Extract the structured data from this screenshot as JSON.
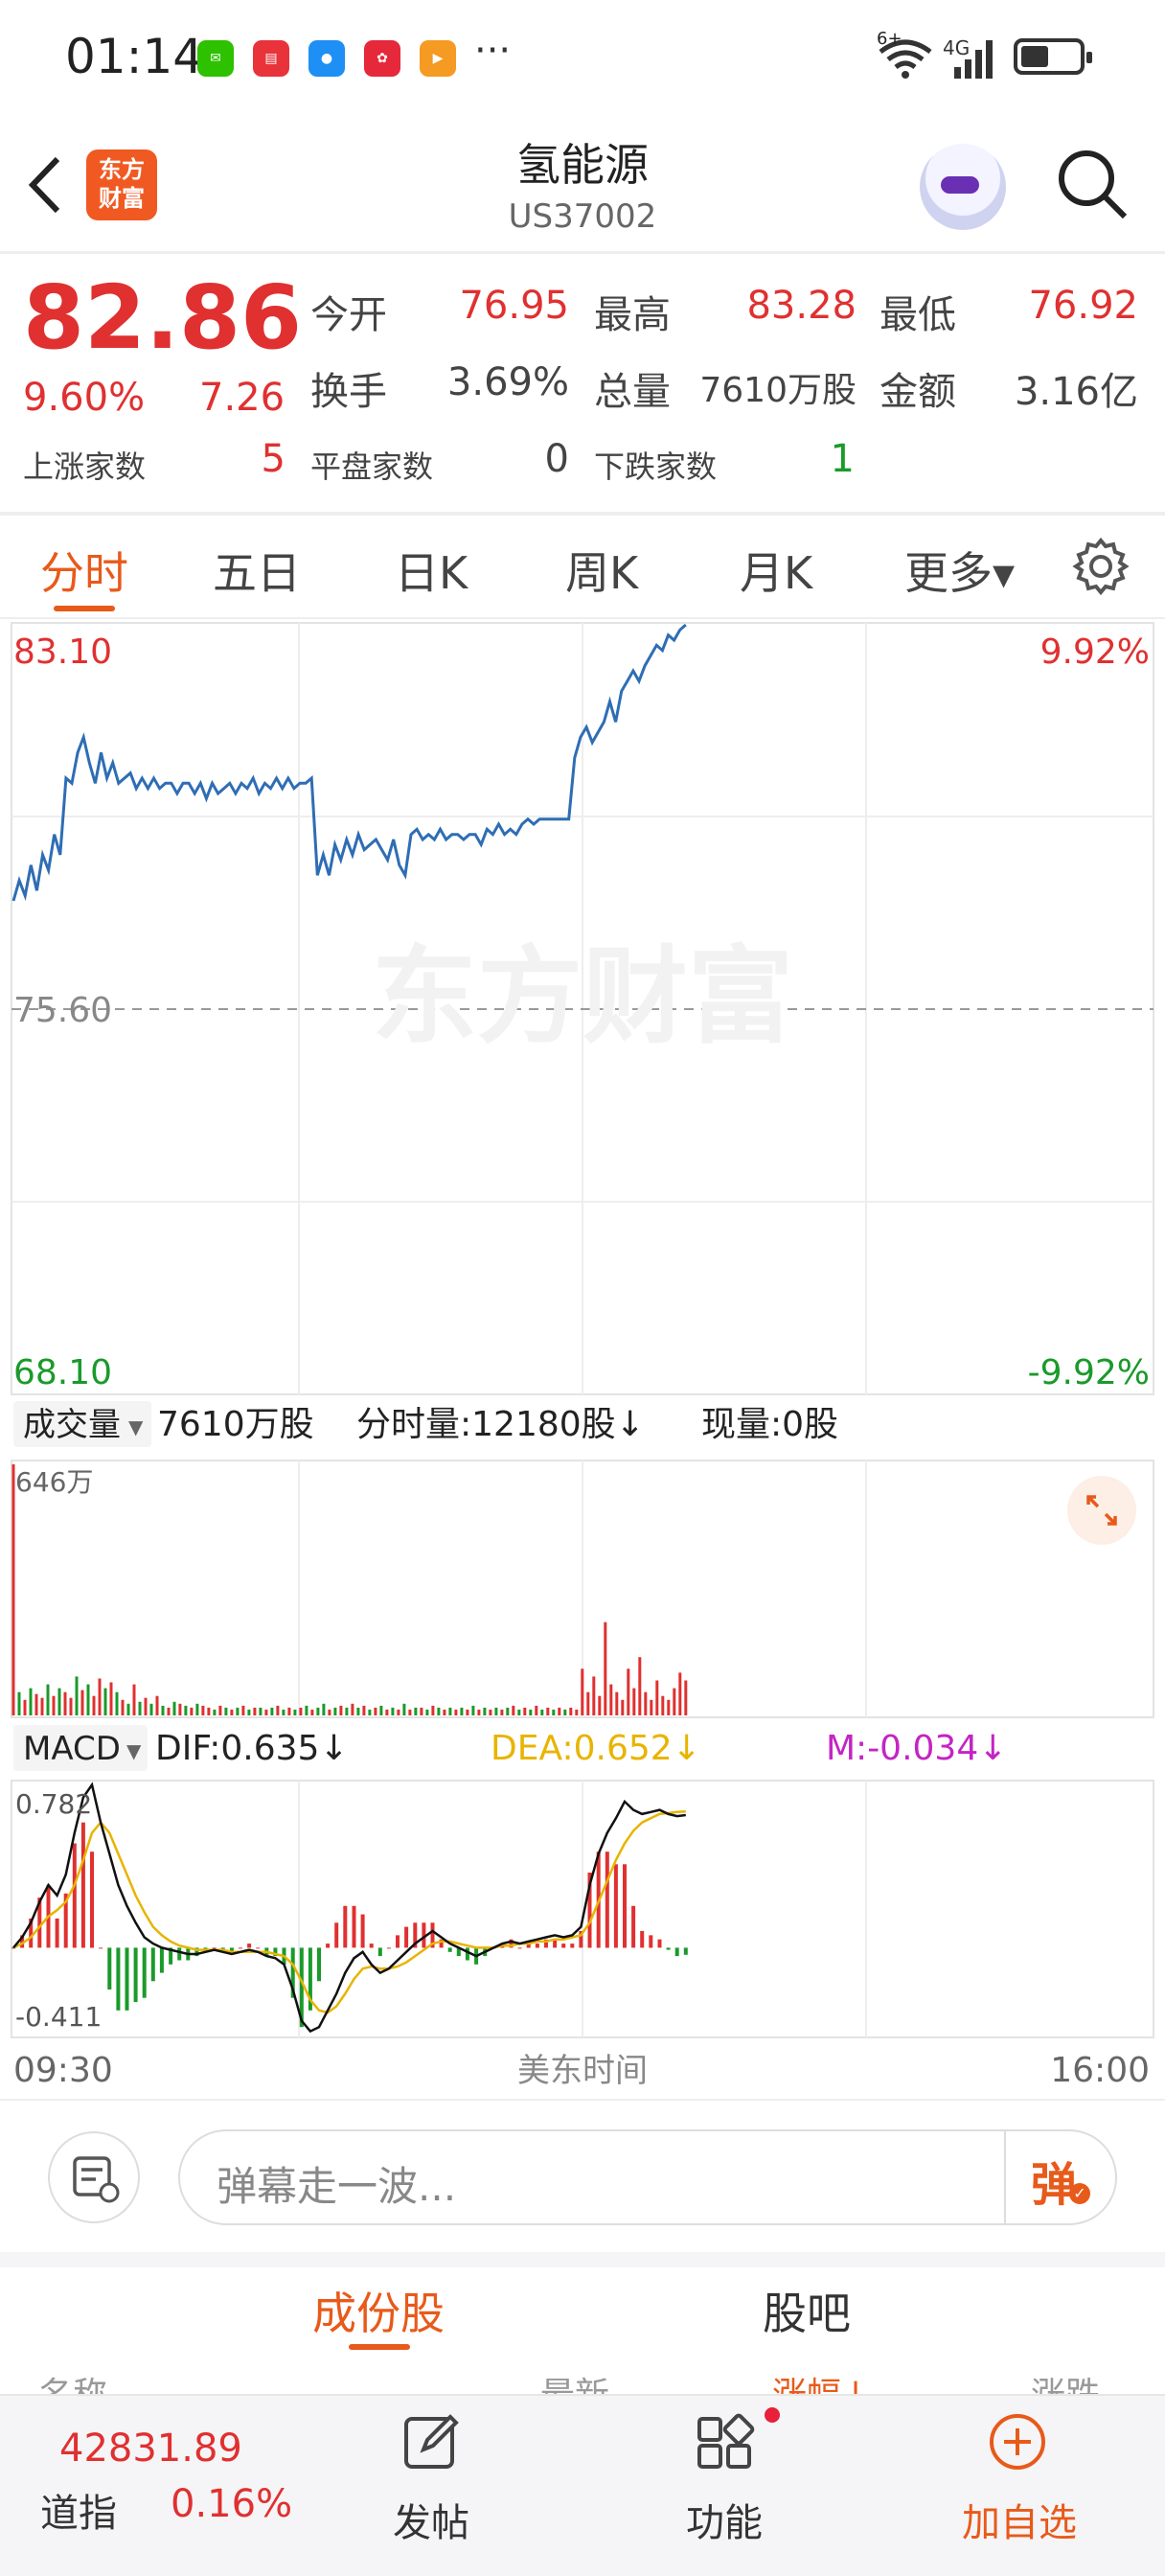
{
  "status_bar": {
    "time": "01:14",
    "dots": "···",
    "net_label": "6+",
    "cell_label": "4G",
    "apps": [
      {
        "name": "wechat",
        "color": "#2dc100"
      },
      {
        "name": "notes",
        "color": "#e8333a"
      },
      {
        "name": "messages",
        "color": "#1e8ff5"
      },
      {
        "name": "huawei-store",
        "color": "#e5283a"
      },
      {
        "name": "video",
        "color": "#f59a23"
      }
    ]
  },
  "header": {
    "logo_line1": "东方",
    "logo_line2": "财富",
    "title": "氢能源",
    "code": "US37002"
  },
  "quote": {
    "price": "82.86",
    "change_pct": "9.60%",
    "change": "7.26",
    "stats": [
      {
        "label": "今开",
        "value": "76.95",
        "color": "red"
      },
      {
        "label": "最高",
        "value": "83.28",
        "color": "red"
      },
      {
        "label": "最低",
        "value": "76.92",
        "color": "red"
      },
      {
        "label": "换手",
        "value": "3.69%",
        "color": "gray"
      },
      {
        "label": "总量",
        "value": "7610万股",
        "color": "gray"
      },
      {
        "label": "金额",
        "value": "3.16亿",
        "color": "gray"
      }
    ],
    "breadth": [
      {
        "label": "上涨家数",
        "value": "5",
        "color": "red"
      },
      {
        "label": "平盘家数",
        "value": "0",
        "color": "gray"
      },
      {
        "label": "下跌家数",
        "value": "1",
        "color": "green"
      }
    ]
  },
  "tabs": [
    {
      "label": "分时",
      "active": true
    },
    {
      "label": "五日",
      "active": false
    },
    {
      "label": "日K",
      "active": false
    },
    {
      "label": "周K",
      "active": false
    },
    {
      "label": "月K",
      "active": false
    },
    {
      "label": "更多▾",
      "active": false
    }
  ],
  "chart_labels": {
    "top_price": "83.10",
    "top_pct": "9.92%",
    "mid_price": "75.60",
    "bottom_price": "68.10",
    "bottom_pct": "-9.92%",
    "watermark": "东方财富",
    "volume_selector": "成交量",
    "volume_total": "7610万股",
    "minute_volume": "分时量:12180股↓",
    "current_volume": "现量:0股",
    "volume_max": "646万",
    "macd_selector": "MACD",
    "dif": "DIF:0.635↓",
    "dea": "DEA:0.652↓",
    "m": "M:-0.034↓",
    "macd_max": "0.782",
    "macd_min": "-0.411",
    "time_start": "09:30",
    "time_mid": "美东时间",
    "time_end": "16:00"
  },
  "chart_data": [
    {
      "type": "line",
      "name": "price",
      "ylim": [
        68.1,
        83.1
      ],
      "baseline": 75.6,
      "x_range": [
        "09:30",
        "16:00"
      ],
      "x": [
        0,
        2,
        4,
        6,
        8,
        10,
        12,
        14,
        16,
        18,
        20,
        22,
        24,
        26,
        28,
        30,
        32,
        34,
        36,
        38,
        40,
        42,
        44,
        46,
        48,
        50,
        52,
        54,
        56,
        58,
        60,
        62,
        64,
        66,
        68,
        70,
        72,
        74,
        76,
        78,
        80,
        82,
        84,
        86,
        88,
        90,
        92,
        94,
        96,
        98,
        100,
        102,
        104,
        106,
        108,
        110,
        112,
        114,
        116,
        118,
        120,
        122,
        124,
        126,
        128,
        130,
        132,
        134,
        136,
        138,
        140,
        142,
        144,
        146,
        148,
        150,
        152,
        154,
        156,
        158,
        160,
        162,
        164,
        166,
        168,
        170,
        172,
        174,
        176,
        178,
        180,
        182,
        184,
        186,
        188,
        190,
        192,
        194,
        196,
        198,
        200,
        202,
        204,
        206,
        208,
        210,
        212,
        214,
        216,
        218,
        220,
        222,
        224,
        226,
        228,
        230
      ],
      "values": [
        77.7,
        78.1,
        77.8,
        78.4,
        77.9,
        78.6,
        78.3,
        79.0,
        78.6,
        80.1,
        80.0,
        80.6,
        80.9,
        80.4,
        80.0,
        80.6,
        80.1,
        80.4,
        80.0,
        80.1,
        80.2,
        79.9,
        80.1,
        79.9,
        80.1,
        79.9,
        80.0,
        80.0,
        79.8,
        80.0,
        80.0,
        79.8,
        80.0,
        79.7,
        80.0,
        79.8,
        79.9,
        80.0,
        79.8,
        80.0,
        79.9,
        80.1,
        79.8,
        80.0,
        79.9,
        80.1,
        79.9,
        80.1,
        79.9,
        80.0,
        80.0,
        80.1,
        78.2,
        78.6,
        78.2,
        78.8,
        78.5,
        78.9,
        78.6,
        79.0,
        78.7,
        78.8,
        78.9,
        78.7,
        78.5,
        78.9,
        78.4,
        78.2,
        79.0,
        79.1,
        78.9,
        79.0,
        78.9,
        79.1,
        78.9,
        79.0,
        79.0,
        78.9,
        79.0,
        79.0,
        78.8,
        79.1,
        79.0,
        79.2,
        79.0,
        79.1,
        79.0,
        79.2,
        79.3,
        79.2,
        79.3,
        79.3,
        79.3,
        79.3,
        79.3,
        79.3,
        80.5,
        80.9,
        81.1,
        80.8,
        81.0,
        81.2,
        81.6,
        81.2,
        81.8,
        82.0,
        82.2,
        82.0,
        82.3,
        82.5,
        82.7,
        82.6,
        82.9,
        82.8,
        83.0,
        83.1
      ]
    },
    {
      "type": "bar",
      "name": "volume",
      "ylim": [
        0,
        646
      ],
      "unit": "万股",
      "values": [
        646,
        60,
        40,
        70,
        55,
        45,
        80,
        50,
        70,
        60,
        45,
        100,
        65,
        80,
        50,
        95,
        70,
        85,
        60,
        40,
        30,
        80,
        35,
        45,
        30,
        50,
        25,
        20,
        35,
        30,
        25,
        20,
        30,
        25,
        20,
        15,
        25,
        20,
        15,
        20,
        25,
        15,
        20,
        20,
        15,
        20,
        25,
        15,
        20,
        15,
        20,
        25,
        15,
        20,
        30,
        15,
        20,
        25,
        20,
        30,
        20,
        25,
        15,
        20,
        25,
        15,
        20,
        15,
        30,
        15,
        20,
        20,
        15,
        25,
        20,
        15,
        20,
        15,
        20,
        15,
        25,
        15,
        20,
        15,
        20,
        15,
        20,
        25,
        15,
        20,
        15,
        25,
        15,
        20,
        15,
        20,
        15,
        20,
        15,
        120,
        60,
        100,
        50,
        240,
        80,
        60,
        40,
        120,
        70,
        150,
        60,
        40,
        90,
        50,
        40,
        70,
        110,
        90
      ],
      "up": [
        true,
        false,
        true,
        false,
        true,
        true,
        false,
        true,
        false,
        true,
        true,
        false,
        true,
        false,
        true,
        true,
        false,
        true,
        false,
        true,
        false,
        true,
        false,
        true,
        false,
        true,
        false,
        true,
        false,
        true,
        false,
        true,
        false,
        true,
        true,
        false,
        true,
        false,
        true,
        false,
        true,
        false,
        true,
        false,
        true,
        false,
        true,
        false,
        true,
        false,
        true,
        false,
        true,
        false,
        false,
        true,
        false,
        true,
        false,
        true,
        false,
        true,
        false,
        true,
        false,
        true,
        false,
        true,
        false,
        true,
        false,
        true,
        false,
        true,
        false,
        true,
        false,
        true,
        false,
        true,
        false,
        true,
        false,
        true,
        false,
        true,
        false,
        true,
        false,
        true,
        false,
        true,
        false,
        true,
        false,
        true,
        false,
        true,
        true,
        true,
        true,
        true,
        true,
        true,
        true,
        true,
        true,
        true,
        true,
        true,
        true,
        true,
        true,
        true,
        true,
        true,
        true,
        true
      ]
    },
    {
      "type": "line",
      "name": "MACD",
      "ylim": [
        -0.411,
        0.782
      ],
      "series": [
        {
          "name": "DIF",
          "values": [
            0.0,
            0.05,
            0.12,
            0.22,
            0.3,
            0.25,
            0.35,
            0.55,
            0.72,
            0.78,
            0.6,
            0.45,
            0.3,
            0.2,
            0.12,
            0.05,
            0.02,
            0.0,
            -0.01,
            -0.02,
            -0.03,
            -0.03,
            -0.02,
            -0.01,
            -0.02,
            -0.03,
            -0.02,
            -0.01,
            -0.02,
            -0.04,
            -0.05,
            -0.08,
            -0.2,
            -0.35,
            -0.4,
            -0.38,
            -0.3,
            -0.22,
            -0.12,
            -0.05,
            -0.02,
            -0.08,
            -0.12,
            -0.1,
            -0.06,
            -0.02,
            0.02,
            0.05,
            0.08,
            0.05,
            0.02,
            0.0,
            -0.02,
            -0.04,
            -0.02,
            0.0,
            0.02,
            0.03,
            0.02,
            0.03,
            0.04,
            0.05,
            0.06,
            0.05,
            0.06,
            0.1,
            0.3,
            0.45,
            0.55,
            0.62,
            0.7,
            0.66,
            0.64,
            0.65,
            0.66,
            0.64,
            0.63,
            0.635
          ]
        },
        {
          "name": "DEA",
          "values": [
            0.0,
            0.02,
            0.05,
            0.1,
            0.15,
            0.18,
            0.22,
            0.3,
            0.42,
            0.55,
            0.6,
            0.55,
            0.45,
            0.35,
            0.25,
            0.17,
            0.1,
            0.06,
            0.03,
            0.01,
            0.0,
            -0.01,
            -0.01,
            -0.01,
            -0.01,
            -0.02,
            -0.02,
            -0.02,
            -0.02,
            -0.02,
            -0.03,
            -0.04,
            -0.08,
            -0.16,
            -0.25,
            -0.3,
            -0.31,
            -0.28,
            -0.22,
            -0.15,
            -0.1,
            -0.09,
            -0.1,
            -0.1,
            -0.09,
            -0.07,
            -0.04,
            -0.01,
            0.02,
            0.03,
            0.03,
            0.02,
            0.01,
            0.0,
            0.0,
            0.0,
            0.01,
            0.01,
            0.02,
            0.02,
            0.03,
            0.03,
            0.04,
            0.04,
            0.05,
            0.06,
            0.12,
            0.22,
            0.32,
            0.42,
            0.5,
            0.56,
            0.6,
            0.62,
            0.64,
            0.645,
            0.65,
            0.652
          ]
        }
      ]
    }
  ],
  "danmu": {
    "placeholder": "弹幕走一波...",
    "button": "弹"
  },
  "sections": [
    {
      "label": "成份股",
      "active": true
    },
    {
      "label": "股吧",
      "active": false
    }
  ],
  "table_head": {
    "name": "名称",
    "latest": "最新",
    "change": "涨幅↓",
    "amount": "涨跌"
  },
  "bottom_nav": {
    "index_value": "42831.89",
    "index_name": "道指",
    "index_pct": "0.16%",
    "post": "发帖",
    "features": "功能",
    "add": "加自选"
  },
  "colors": {
    "up": "#e03030",
    "down": "#1a9a2a",
    "accent": "#e85a1a",
    "line": "#2e6db4",
    "dea": "#e8b400",
    "m": "#c424c4"
  }
}
